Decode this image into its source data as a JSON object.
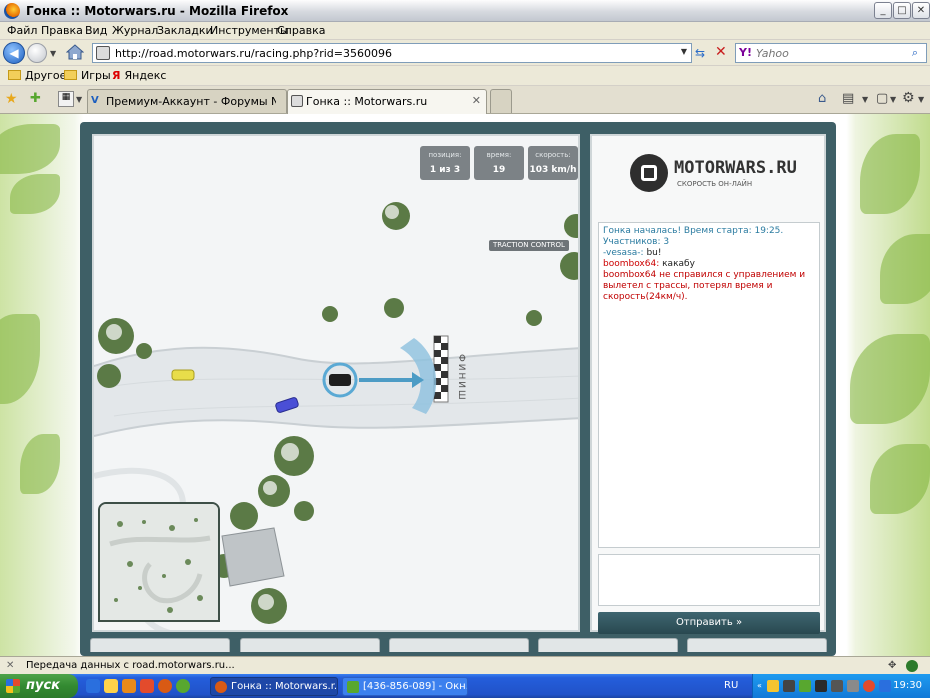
{
  "window": {
    "title": "Гонка :: Motorwars.ru - Mozilla Firefox",
    "controls": {
      "minimize": "_",
      "maximize": "□",
      "close": "✕"
    }
  },
  "menu": [
    "Файл",
    "Правка",
    "Вид",
    "Журнал",
    "Закладки",
    "Инструменты",
    "Справка"
  ],
  "nav": {
    "url": "http://road.motorwars.ru/racing.php?rid=3560096",
    "search_placeholder": "Yahoo"
  },
  "bookmarks": [
    "Другое",
    "Игры",
    "Яндекс"
  ],
  "tabs": [
    {
      "label": "Премиум-Аккаунт - Форумы Netg...",
      "active": false
    },
    {
      "label": "Гонка :: Motorwars.ru",
      "active": true
    }
  ],
  "game": {
    "hud": [
      {
        "label": "позиция:",
        "value": "1 из 3"
      },
      {
        "label": "время:",
        "value": "19"
      },
      {
        "label": "скорость:",
        "value": "103 km/h"
      }
    ],
    "traction_control": "TRACTION CONTROL",
    "finish_label": "ФИНИШ"
  },
  "site": {
    "logo_name": "MOTORWARS.RU",
    "logo_slogan": "СКОРОСТЬ ОН-ЛАЙН"
  },
  "chat": {
    "system_message": "Гонка началась! Время старта: 19:25. Участников: 3",
    "messages": [
      {
        "user": "-vesasa-:",
        "text": "bu!"
      },
      {
        "user": "boombox64:",
        "text": "какабу"
      }
    ],
    "crash_message": "boombox64 не справился с управлением и вылетел с трассы, потерял время и скорость(24км/ч).",
    "send_label": "Отправить »"
  },
  "status": {
    "text": "Передача данных с road.motorwars.ru..."
  },
  "taskbar": {
    "start": "пуск",
    "tasks": [
      {
        "label": "Гонка :: Motorwars.r...",
        "active": true
      },
      {
        "label": "[436-856-089] - Окн...",
        "active": false
      }
    ],
    "language": "RU",
    "clock": "19:30"
  }
}
